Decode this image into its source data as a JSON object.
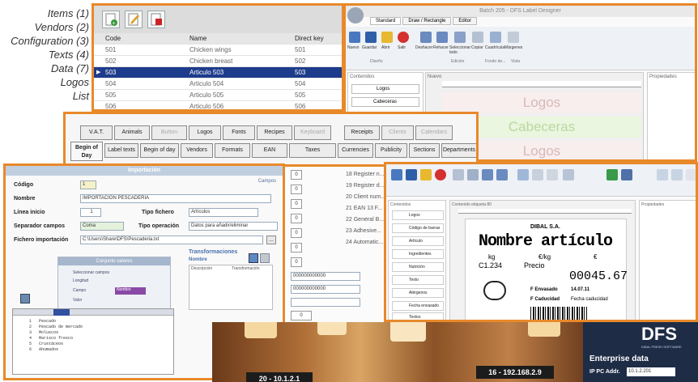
{
  "menu": [
    "Items (1)",
    "Vendors (2)",
    "Configuration (3)",
    "Texts (4)",
    "Data (7)",
    "Logos",
    "List"
  ],
  "items_table": {
    "headers": [
      "Code",
      "Name",
      "Direct key"
    ],
    "rows": [
      [
        "501",
        "Chicken wings",
        "501"
      ],
      [
        "502",
        "Chicken breast",
        "502"
      ],
      [
        "503",
        "Articulo 503",
        "503"
      ],
      [
        "504",
        "Articulo 504",
        "504"
      ],
      [
        "505",
        "Articulo 505",
        "505"
      ],
      [
        "506",
        "Articulo 506",
        "506"
      ]
    ],
    "selected_index": 2
  },
  "designer": {
    "title": "Batch 205 - DFS Label Designer",
    "tabs": [
      "Standard",
      "Draw / Rectangle",
      "Editor"
    ],
    "ribbon": [
      "Nuevo",
      "Guardar",
      "Abrir",
      "Salir",
      "Deshacer",
      "Rehacer",
      "Seleccionar todo",
      "Copiar",
      "Cuadrícula",
      "Márgenes"
    ],
    "groups": [
      "Diseño",
      "Edición",
      "Fondo de...",
      "Vista"
    ],
    "left_panel_title": "Contenidos",
    "left_panel_items": [
      "Logos",
      "Cabeceras"
    ],
    "center_title": "Nuevo",
    "right_panel_title": "Propiedades",
    "canvas_items": [
      "Logos",
      "Cabeceras",
      "Logos"
    ]
  },
  "tabs_window": {
    "row1": [
      "V.A.T.",
      "Animals",
      "Button",
      "Logos",
      "Fonts",
      "Recipes",
      "Keyboard",
      "Receipts",
      "Clients",
      "Calendars"
    ],
    "row1_disabled": [
      2,
      6,
      8,
      9
    ],
    "row2": [
      "Begin of Day",
      "Label texts",
      "Begin of day",
      "Vendors",
      "Formats",
      "EAN",
      "Taxes",
      "Currencies",
      "Publicity",
      "Sections",
      "Departments"
    ]
  },
  "config_list": {
    "items": [
      "18 Register n...",
      "19 Register d...",
      "20 Client num...",
      "21 EAN 13 F...",
      "22 General B...",
      "23 Adhesive...",
      "24 Automatic..."
    ],
    "values": [
      "0",
      "0",
      "0",
      "0",
      "0",
      "0",
      "0",
      "0",
      "0",
      "0",
      "0"
    ],
    "long_fields": [
      "000000000000",
      "000000000000"
    ]
  },
  "importacion": {
    "title": "Importación",
    "link": "Campos",
    "codigo_label": "Código",
    "codigo_value": "1",
    "nombre_label": "Nombre",
    "nombre_value": "IMPORTACION PESCADERIA",
    "linea_label": "Línea inicio",
    "linea_value": "1",
    "tipo_fichero_label": "Tipo fichero",
    "tipo_fichero_value": "Artículos",
    "separador_label": "Separador campos",
    "separador_value": "Coma",
    "tipo_op_label": "Tipo operación",
    "tipo_op_value": "Datos para añadir/eliminar",
    "fichero_label": "Fichero importación",
    "fichero_value": "C:\\Users\\Share\\DFS\\Pescaderia.txt",
    "trans_title": "Transformaciones",
    "trans_sub": "Nombre",
    "trans_cols": [
      "Descripción",
      "Transformación"
    ],
    "dlg_title": "Conjunto valores",
    "dlg_rows": [
      "Seleccionar campos",
      "Longitud",
      "Campo",
      "Valor"
    ],
    "dlg_value": "Nombre",
    "list_rows": [
      "1",
      "2",
      "3",
      "4",
      "5",
      "6"
    ],
    "list_texts": [
      "Pescado",
      "Pescado de mercado",
      "Moluscos",
      "Marisco fresco",
      "Crustáceos",
      "Ahumados"
    ]
  },
  "designer2": {
    "sidebar_title": "Contenidos",
    "sidebar_items": [
      "Logos",
      "Código de barras",
      "Artículo",
      "Ingredientes",
      "Nutrición",
      "Texto",
      "Alérgenos",
      "Fecha envasado",
      "Textos"
    ],
    "center_title": "Contenido etiqueta 80",
    "right_title": "Propiedades",
    "label_company": "DIBAL S.A.",
    "label_name": "Nombre artículo",
    "label_kg": "kg",
    "label_price_unit": "€/kg",
    "label_euro": "€",
    "label_weight": "C1.234",
    "label_price_word": "Precio",
    "label_total": "00045.67",
    "label_pack": "F Envasado",
    "label_pack_date": "14.07.11",
    "label_exp": "F Caducidad",
    "label_exp_text": "Fecha caducidad"
  },
  "restaurant": {
    "sign1": "20 - 10.1.2.1",
    "sign2": "16 - 192.168.2.9",
    "brand": "DFS",
    "brand_sub": "DIBAL FRESH SOFTWARE",
    "enterprise": "Enterprise data",
    "ip_label": "IP PC Addr.",
    "ip_value": "10.1.2.201"
  }
}
